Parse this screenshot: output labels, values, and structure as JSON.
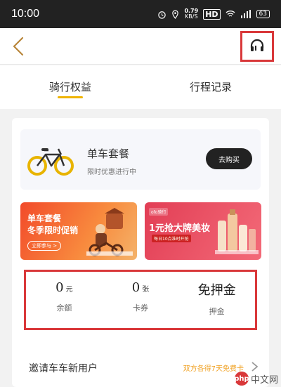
{
  "status_bar": {
    "time": "10:00",
    "speed_value": "0.79",
    "speed_unit": "KB/S",
    "hd": "HD",
    "battery": "63"
  },
  "header": {
    "back_icon": "chevron-left-icon",
    "support_icon": "headset-icon"
  },
  "tabs": [
    {
      "label": "骑行权益",
      "active": true
    },
    {
      "label": "行程记录",
      "active": false
    }
  ],
  "package": {
    "title": "单车套餐",
    "subtitle": "限时优惠进行中",
    "buy_label": "去购买"
  },
  "banners": {
    "left": {
      "line1": "单车套餐",
      "line2": "冬季限时促销",
      "cta": "立即参与 >"
    },
    "right": {
      "tag": "ofo骑行",
      "title": "1元抢大牌美妆",
      "sub": "每日10点准时开抢"
    }
  },
  "stats": [
    {
      "value": "0",
      "unit": "元",
      "label": "余额"
    },
    {
      "value": "0",
      "unit": "张",
      "label": "卡券"
    },
    {
      "value": "免押金",
      "unit": "",
      "label": "押金"
    }
  ],
  "invite": {
    "title": "邀请车车新用户",
    "link": "双方各得7天免费卡"
  },
  "watermark": {
    "logo": "php",
    "text": "中文网"
  },
  "colors": {
    "accent": "#f0b400",
    "highlight": "#d9383a",
    "invite_link": "#f0a020"
  }
}
